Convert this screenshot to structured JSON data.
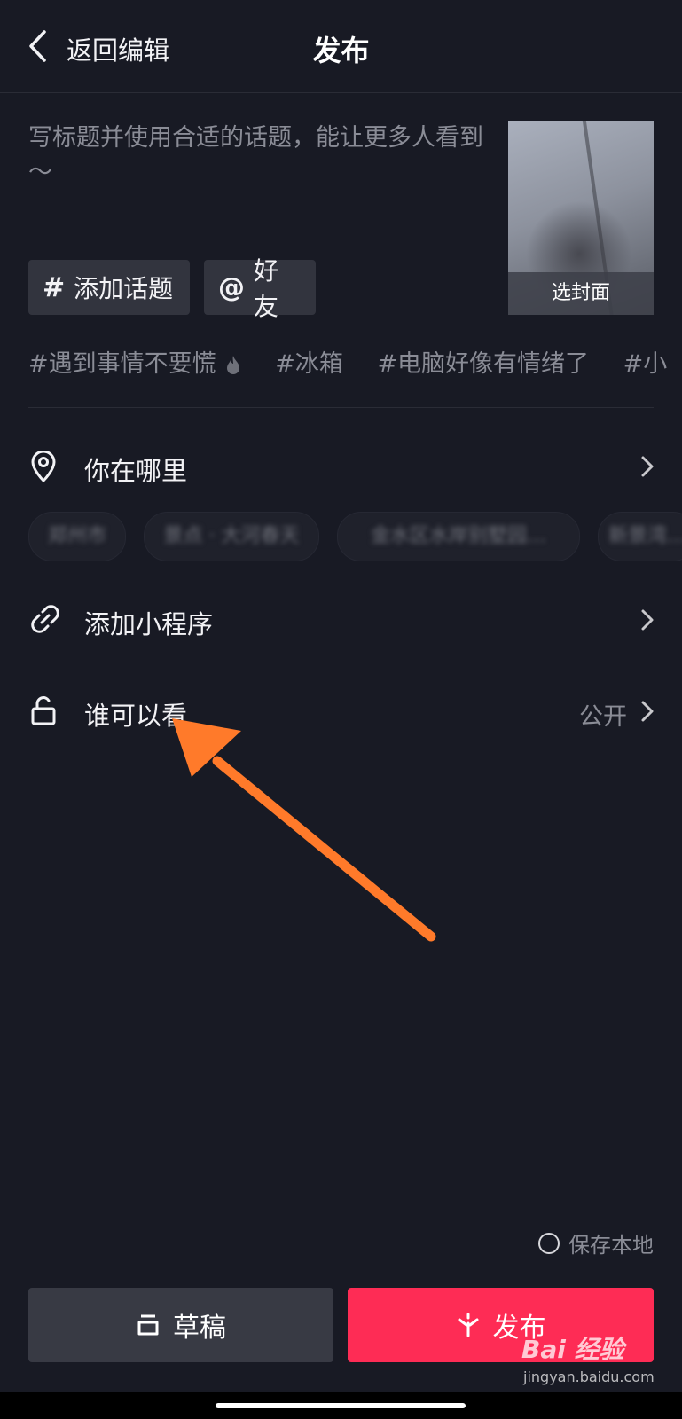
{
  "header": {
    "back_label": "返回编辑",
    "title": "发布"
  },
  "compose": {
    "placeholder": "写标题并使用合适的话题，能让更多人看到～",
    "cover_label": "选封面"
  },
  "chips": {
    "topic": "添加话题",
    "friend": "好友"
  },
  "hashtags": [
    "#遇到事情不要慌",
    "#冰箱",
    "#电脑好像有情绪了",
    "#小"
  ],
  "location": {
    "label": "你在哪里",
    "suggestions": [
      "郑州市",
      "景点 · 大河春天",
      "金水区水岸别墅园…",
      "新景湾…"
    ]
  },
  "mini_program": {
    "label": "添加小程序"
  },
  "visibility": {
    "label": "谁可以看",
    "value": "公开"
  },
  "save_local": "保存本地",
  "buttons": {
    "draft": "草稿",
    "publish": "发布"
  },
  "watermark": {
    "brand": "Bai 经验",
    "url": "jingyan.baidu.com"
  },
  "colors": {
    "background": "#181a24",
    "publish": "#fe2c55",
    "draft": "#383a44",
    "arrow": "#ff7a2a"
  }
}
